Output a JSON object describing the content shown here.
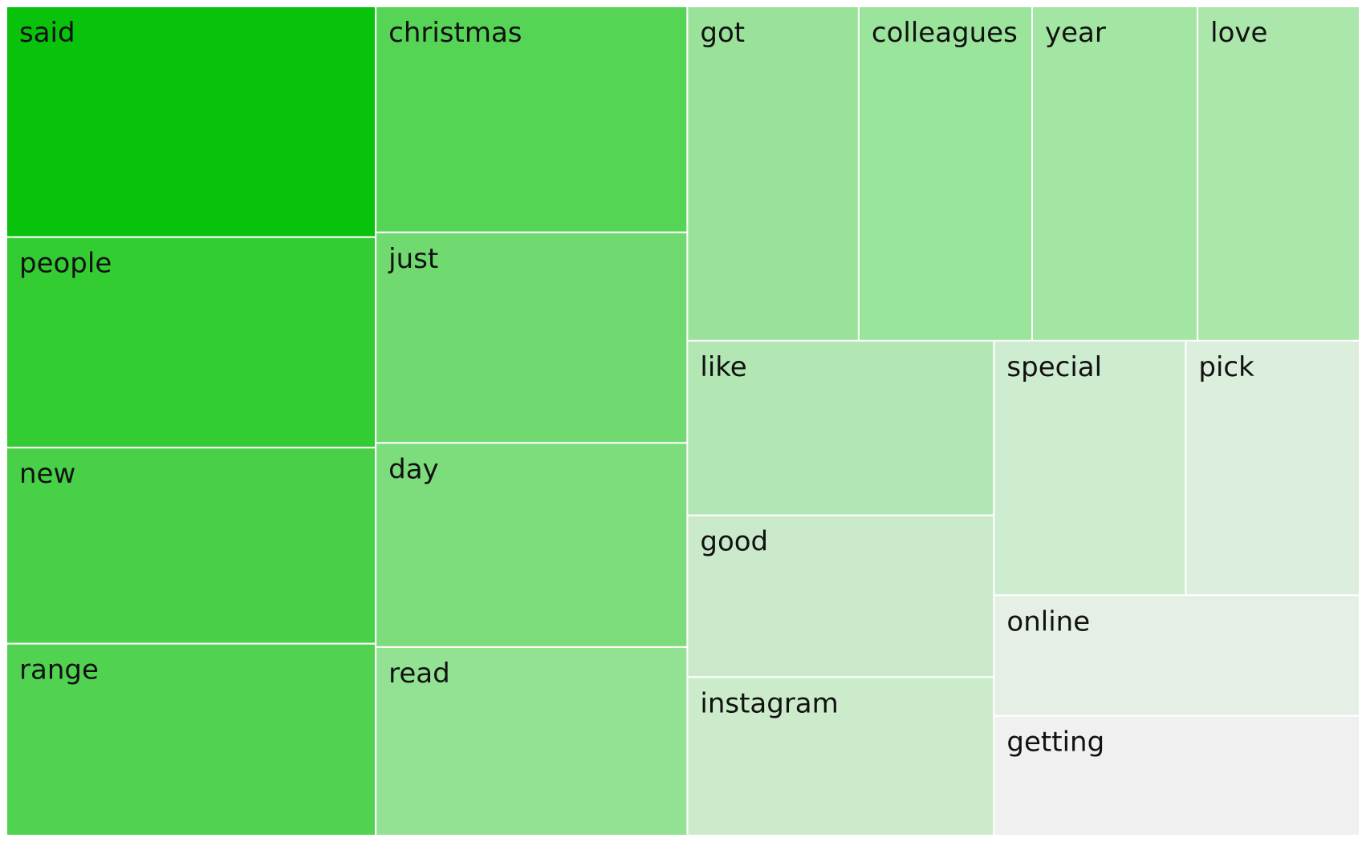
{
  "chart_data": {
    "type": "treemap",
    "title": "",
    "items": [
      {
        "label": "said",
        "value": 1117,
        "color": "#08c20c"
      },
      {
        "label": "people",
        "value": 1019,
        "color": "#33cc33"
      },
      {
        "label": "new",
        "value": 949,
        "color": "#48d148"
      },
      {
        "label": "range",
        "value": 929,
        "color": "#51d351"
      },
      {
        "label": "christmas",
        "value": 923,
        "color": "#55d455"
      },
      {
        "label": "just",
        "value": 860,
        "color": "#70da70"
      },
      {
        "label": "day",
        "value": 834,
        "color": "#7ddd7d"
      },
      {
        "label": "read",
        "value": 770,
        "color": "#93e293"
      },
      {
        "label": "got",
        "value": 751,
        "color": "#9ae29a"
      },
      {
        "label": "colleagues",
        "value": 760,
        "color": "#9be49b"
      },
      {
        "label": "year",
        "value": 725,
        "color": "#a3e6a3"
      },
      {
        "label": "love",
        "value": 710,
        "color": "#abe6ab"
      },
      {
        "label": "like",
        "value": 702,
        "color": "#b2e6b2"
      },
      {
        "label": "good",
        "value": 650,
        "color": "#cae9ca"
      },
      {
        "label": "instagram",
        "value": 637,
        "color": "#cbebcb"
      },
      {
        "label": "special",
        "value": 640,
        "color": "#ceeccf"
      },
      {
        "label": "pick",
        "value": 580,
        "color": "#dceedc"
      },
      {
        "label": "online",
        "value": 578,
        "color": "#e5efe5"
      },
      {
        "label": "getting",
        "value": 574,
        "color": "#f0f0f0"
      }
    ]
  }
}
